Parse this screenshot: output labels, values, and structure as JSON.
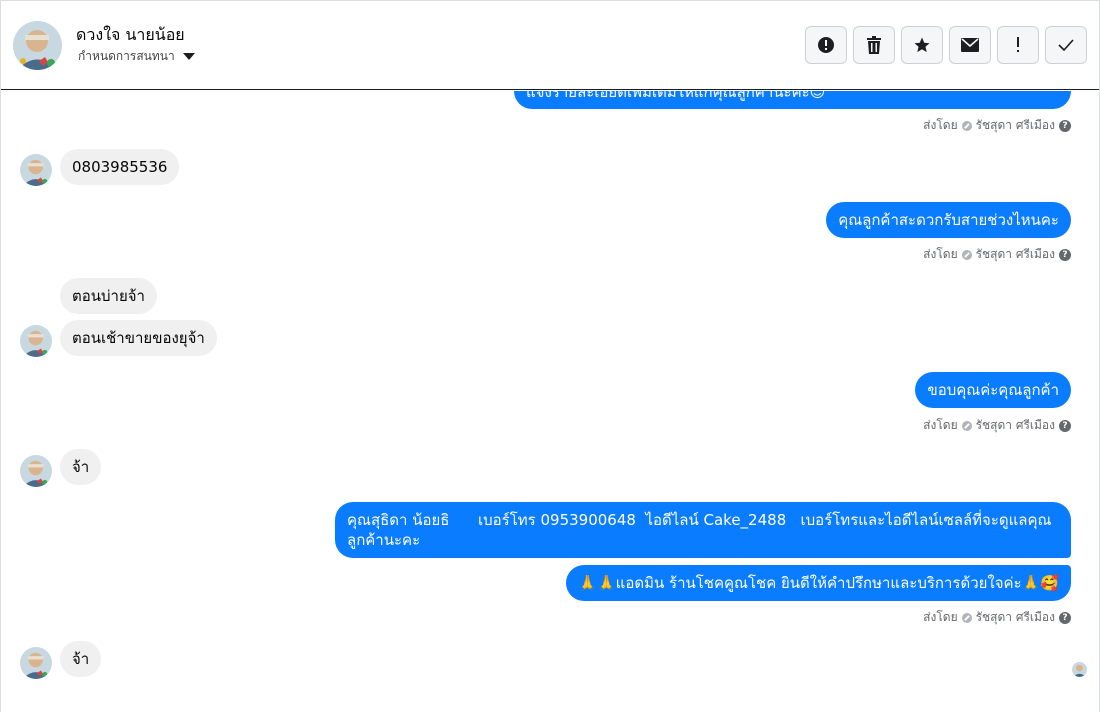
{
  "header": {
    "contact_name": "ดวงใจ นายน้อย",
    "assign_label": "กำหนดการสนทนา"
  },
  "actions": [
    {
      "icon": "alert-circle-icon",
      "label": "report"
    },
    {
      "icon": "trash-icon",
      "label": "delete"
    },
    {
      "icon": "star-icon",
      "label": "star"
    },
    {
      "icon": "envelope-icon",
      "label": "mark-unread"
    },
    {
      "icon": "exclamation-icon",
      "label": "spam"
    },
    {
      "icon": "check-icon",
      "label": "done"
    }
  ],
  "messages": {
    "m0_partial": "แจ้งรายละเอียดเพิ่มเติมให้แก่คุณลูกค้านะคะ😊",
    "sent_by_prefix": "ส่งโดย",
    "sent_by_name": "รัชสุดา ศรีเมือง",
    "m1": "0803985536",
    "m2": "คุณลูกค้าสะดวกรับสายช่วงไหนคะ",
    "m3": "ตอนบ่ายจ้า",
    "m4": "ตอนเช้าขายของยุจ้า",
    "m5": "ขอบคุณค่ะคุณลูกค้า",
    "m6": "จ้า",
    "m7": "คุณสุธิดา น้อยธิ      เบอร์โทร 0953900648  ไอดีไลน์ Cake_2488   เบอร์โทรและไอดีไลน์เซลล์ที่จะดูแลคุณลูกค้านะคะ",
    "m8": "🙏🙏แอดมิน ร้านโชคคูณโชค ยินดีให้คำปรึกษาและบริการด้วยใจค่ะ🙏🥰",
    "m9": "จ้า"
  },
  "colors": {
    "outgoing_bubble": "#0a7cff",
    "incoming_bubble": "#f0f0f0",
    "meta_text": "#65676b"
  }
}
